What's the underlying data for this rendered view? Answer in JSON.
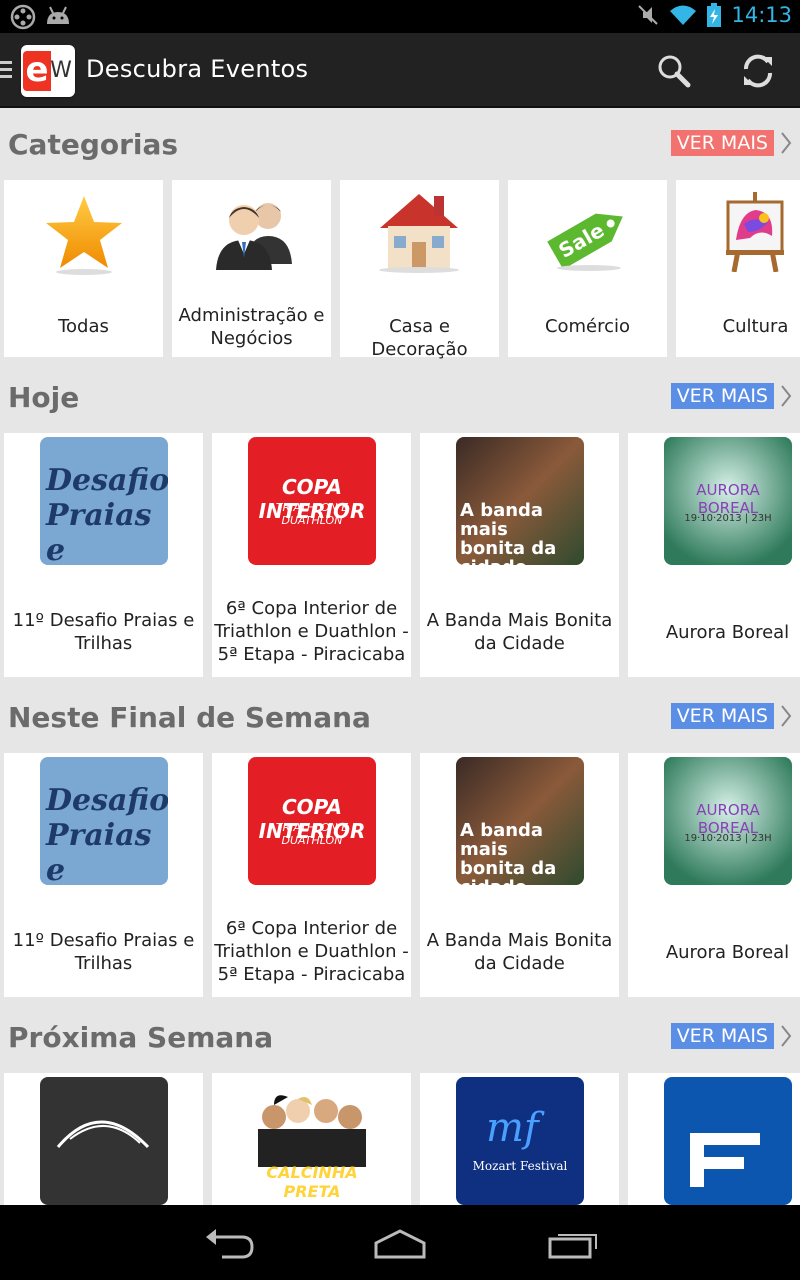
{
  "status_bar": {
    "time": "14:13"
  },
  "app_bar": {
    "title": "Descubra Eventos",
    "logo_e": "e",
    "logo_w": "W"
  },
  "sections": {
    "categorias": {
      "title": "Categorias",
      "more": "VER MAIS",
      "more_color": "#f2726f",
      "items": [
        {
          "label": "Todas",
          "icon": "star-icon"
        },
        {
          "label": "Administração e Negócios",
          "icon": "business-people-icon"
        },
        {
          "label": "Casa e Decoração",
          "icon": "house-icon"
        },
        {
          "label": "Comércio",
          "icon": "sale-tag-icon"
        },
        {
          "label": "Cultura",
          "icon": "easel-icon"
        }
      ]
    },
    "hoje": {
      "title": "Hoje",
      "more": "VER MAIS",
      "more_color": "#5b8fe6",
      "items": [
        {
          "label": "11º Desafio Praias e Trilhas",
          "image_text": "Desafio Praias e Trilhas"
        },
        {
          "label": "6ª Copa Interior de Triathlon e Duathlon - 5ª Etapa - Piracicaba",
          "image_text": "COPA INTERIOR",
          "image_subtext": "TRIATHLON E DUATHLON"
        },
        {
          "label": "A Banda Mais Bonita da Cidade",
          "image_text": "A banda mais bonita da cidade"
        },
        {
          "label": "Aurora Boreal",
          "image_text": "AURORA BOREAL",
          "image_subtext": "19·10·2013 | 23H"
        }
      ]
    },
    "fim_semana": {
      "title": "Neste Final de Semana",
      "more": "VER MAIS",
      "more_color": "#5b8fe6",
      "items": [
        {
          "label": "11º Desafio Praias e Trilhas",
          "image_text": "Desafio Praias e Trilhas"
        },
        {
          "label": "6ª Copa Interior de Triathlon e Duathlon - 5ª Etapa - Piracicaba",
          "image_text": "COPA INTERIOR",
          "image_subtext": "TRIATHLON E DUATHLON"
        },
        {
          "label": "A Banda Mais Bonita da Cidade",
          "image_text": "A banda mais bonita da cidade"
        },
        {
          "label": "Aurora Boreal",
          "image_text": "AURORA BOREAL",
          "image_subtext": "19·10·2013 | 23H"
        }
      ]
    },
    "proxima": {
      "title": "Próxima Semana",
      "more": "VER MAIS",
      "more_color": "#5b8fe6",
      "items": [
        {
          "image_text": ""
        },
        {
          "image_text": "CALCINHA PRETA"
        },
        {
          "image_text": "Mozart Festival"
        },
        {
          "image_text": ""
        }
      ]
    }
  }
}
